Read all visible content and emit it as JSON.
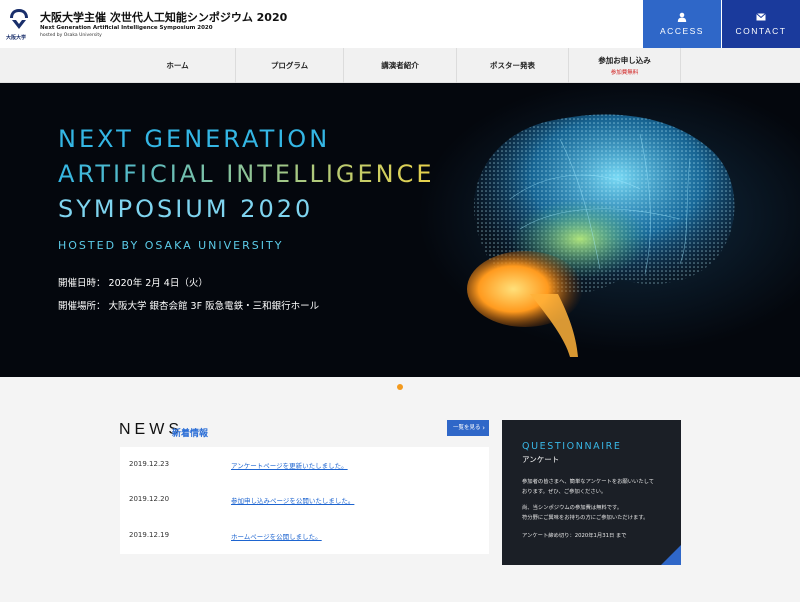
{
  "header": {
    "logo_caption": "大阪大学",
    "title_ja": "大阪大学主催 次世代人工知能シンポジウム 2020",
    "title_en": "Next Generation Artificial Intelligence Symposium 2020",
    "title_host": "hosted by Osaka University",
    "access_label": "ACCESS",
    "contact_label": "CONTACT",
    "access_icon": "user-icon",
    "contact_icon": "mail-icon"
  },
  "nav": {
    "items": [
      {
        "label": "ホーム"
      },
      {
        "label": "プログラム"
      },
      {
        "label": "講演者紹介"
      },
      {
        "label": "ポスター発表"
      },
      {
        "label": "参加お申し込み",
        "note": "参加費無料"
      }
    ]
  },
  "hero": {
    "line1": "NEXT GENERATION",
    "line2": "ARTIFICIAL INTELLIGENCE",
    "line3": "SYMPOSIUM 2020",
    "host": "HOSTED BY OSAKA UNIVERSITY",
    "date": "開催日時：  2020年 2月 4日（火）",
    "venue": "開催場所：  大阪大学 銀杏会館 3F 阪急電鉄・三和銀行ホール",
    "image": "brain-illustration"
  },
  "news": {
    "title": "NEWS",
    "subtitle": "新着情報",
    "more_label": "一覧を見る",
    "items": [
      {
        "date": "2019.12.23",
        "text": "アンケートページを更新いたしました。"
      },
      {
        "date": "2019.12.20",
        "text": "参加申し込みページを公開いたしました。"
      },
      {
        "date": "2019.12.19",
        "text": "ホームページを公開しました。"
      }
    ]
  },
  "questionnaire": {
    "title_en": "QUESTIONNAIRE",
    "title_ja": "アンケート",
    "p1": "参加者の皆さまへ、簡単なアンケートをお願いいたして",
    "p2": "おります。ぜひ、ご参加ください。",
    "p3": "尚、当シンポジウムの参加費は無料です。",
    "p4": "符分野にご興味をお持ちの方にご参加いただけます。",
    "deadline": "アンケート締め切り：2020年1月31日 まで"
  },
  "colors": {
    "accent": "#2f67c8",
    "navy": "#1a3a9c",
    "hero_cyan": "#34b6e4",
    "hero_yellow": "#e9d24a",
    "indicator": "#f39a1e"
  }
}
